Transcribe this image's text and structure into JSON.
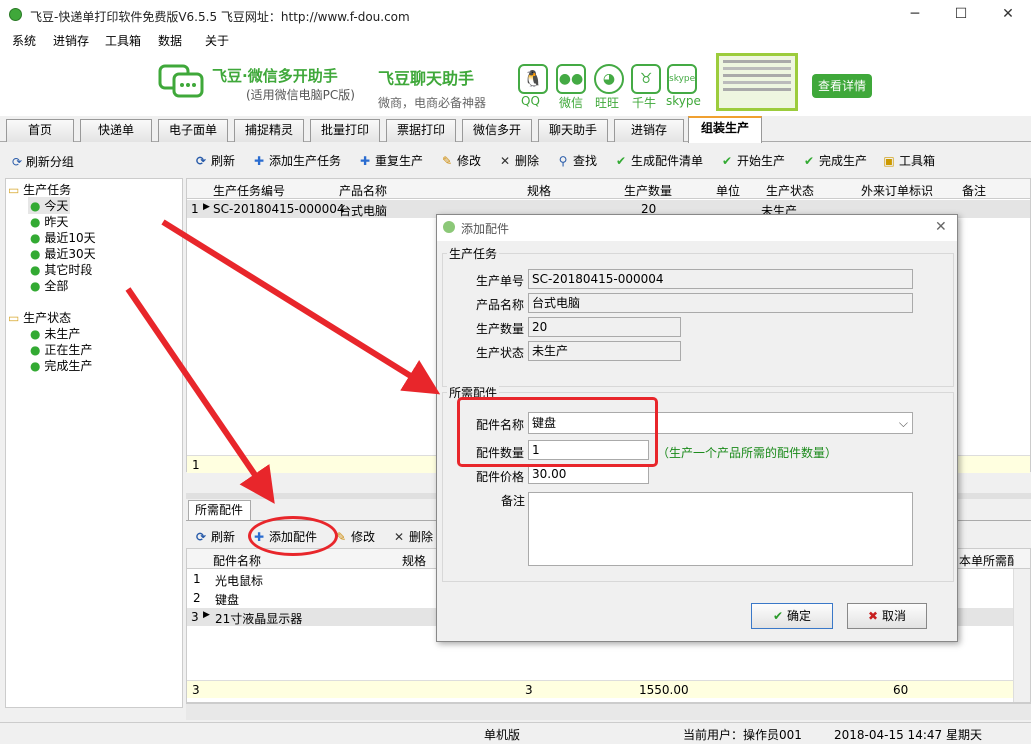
{
  "window": {
    "title": "飞豆-快递单打印软件免费版V6.5.5   飞豆网址：http://www.f-dou.com"
  },
  "menu": [
    "系统",
    "进销存",
    "工具箱",
    "数据",
    "关于"
  ],
  "banner": {
    "brand": "飞豆",
    "brand_suffix": "·微信多开助手",
    "sub": "(适用微信电脑PC版)",
    "title2": "飞豆聊天助手",
    "sub2": "微商，电商必备神器",
    "icons": [
      "QQ",
      "微信",
      "旺旺",
      "千牛",
      "skype"
    ],
    "details_button": "查看详情"
  },
  "tabs": [
    "首页",
    "快递单",
    "电子面单",
    "捕捉精灵",
    "批量打印",
    "票据打印",
    "微信多开",
    "聊天助手",
    "进销存",
    "组装生产"
  ],
  "left": {
    "refresh": "刷新分组",
    "group1": "生产任务",
    "group1_items": [
      "今天",
      "昨天",
      "最近10天",
      "最近30天",
      "其它时段",
      "全部"
    ],
    "group2": "生产状态",
    "group2_items": [
      "未生产",
      "正在生产",
      "完成生产"
    ]
  },
  "toolbar": [
    "刷新",
    "添加生产任务",
    "重复生产",
    "修改",
    "删除",
    "查找",
    "生成配件清单",
    "开始生产",
    "完成生产",
    "工具箱"
  ],
  "grid1": {
    "headers": [
      "生产任务编号",
      "产品名称",
      "规格",
      "生产数量",
      "单位",
      "生产状态",
      "外来订单标识",
      "备注"
    ],
    "row": {
      "num": "1",
      "id": "SC-20180415-000004",
      "name": "台式电脑",
      "qty": "20",
      "status": "未生产"
    },
    "footer_count": "1"
  },
  "panel2": {
    "tab": "所需配件",
    "toolbar": [
      "刷新",
      "添加配件",
      "修改",
      "删除"
    ],
    "headers": [
      "配件名称",
      "规格",
      "本单所需配"
    ],
    "rows": [
      {
        "num": "1",
        "name": "光电鼠标"
      },
      {
        "num": "2",
        "name": "键盘"
      },
      {
        "num": "3",
        "name": "21寸液晶显示器"
      }
    ],
    "footer": {
      "count": "3",
      "a": "3",
      "b": "1550.00",
      "c": "60"
    }
  },
  "dialog": {
    "title": "添加配件",
    "section1": "生产任务",
    "labels1": [
      "生产单号",
      "产品名称",
      "生产数量",
      "生产状态"
    ],
    "values1": [
      "SC-20180415-000004",
      "台式电脑",
      "20",
      "未生产"
    ],
    "section2": "所需配件",
    "part_name_label": "配件名称",
    "part_name_value": "键盘",
    "part_qty_label": "配件数量",
    "part_qty_value": "1",
    "qty_hint": "（生产一个产品所需的配件数量）",
    "part_price_label": "配件价格",
    "part_price_value": "30.00",
    "remark_label": "备注",
    "ok": "确定",
    "cancel": "取消"
  },
  "status": {
    "mode": "单机版",
    "user_label": "当前用户：操作员001",
    "datetime": "2018-04-15 14:47 星期天"
  },
  "colors": {
    "accent_red": "#e8262b",
    "brand_green": "#3fa83a",
    "tab_active_top": "#f0a030"
  }
}
